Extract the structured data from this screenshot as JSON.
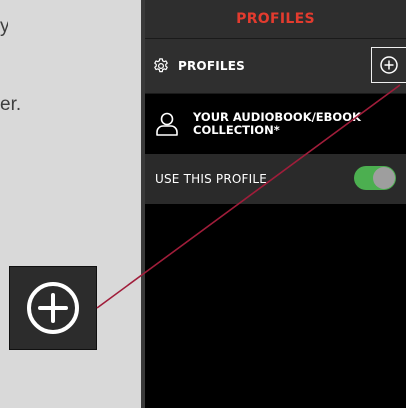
{
  "instructions": {
    "line1_partial": "y",
    "line2_partial": "er."
  },
  "app": {
    "title": "PROFILES",
    "accent_color": "#e33b2e"
  },
  "profiles_section": {
    "icon": "gear-icon",
    "label": "PROFILES",
    "add_icon": "plus-circle-icon"
  },
  "collection": {
    "icon": "user-icon",
    "label": "YOUR AUDIOBOOK/EBOOK COLLECTION*"
  },
  "use_profile": {
    "label": "USE THIS PROFILE",
    "enabled": true,
    "toggle_color": "#4caf50"
  },
  "callout": {
    "icon": "plus-circle-icon"
  }
}
